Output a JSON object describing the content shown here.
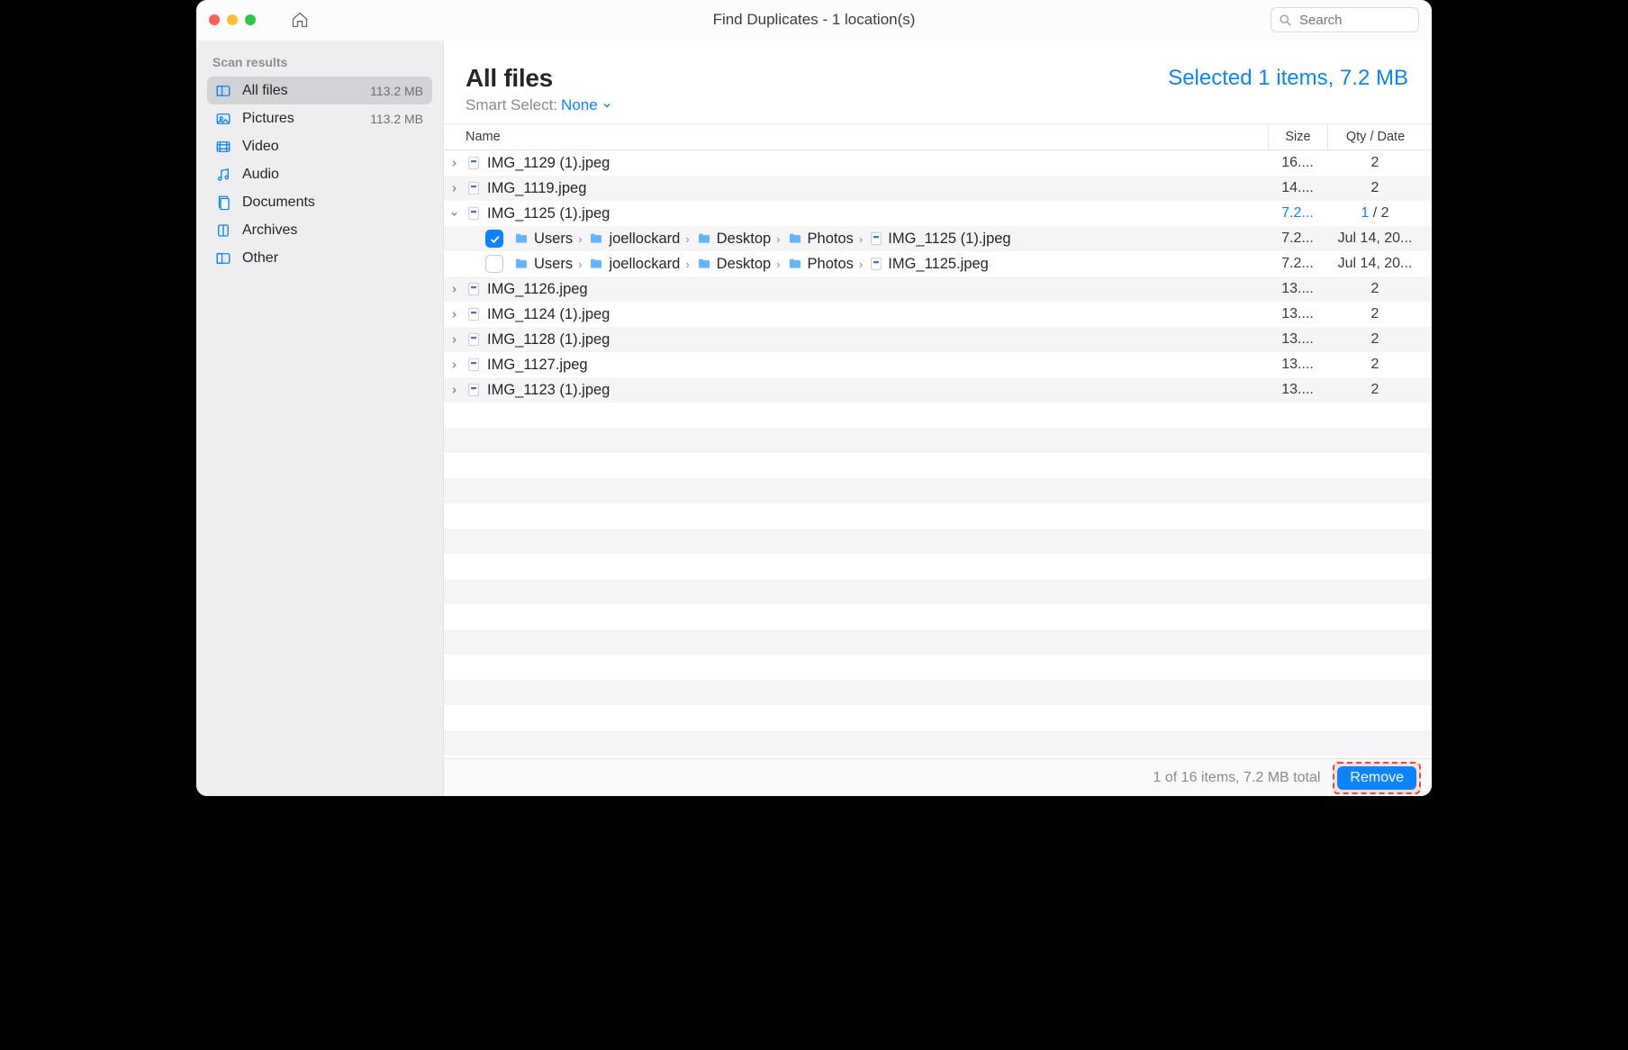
{
  "window_title": "Find Duplicates - 1 location(s)",
  "search": {
    "placeholder": "Search"
  },
  "sidebar": {
    "header": "Scan results",
    "items": [
      {
        "label": "All files",
        "meta": "113.2 MB",
        "icon": "allfiles",
        "active": true
      },
      {
        "label": "Pictures",
        "meta": "113.2 MB",
        "icon": "pictures",
        "active": false
      },
      {
        "label": "Video",
        "meta": "",
        "icon": "video",
        "active": false
      },
      {
        "label": "Audio",
        "meta": "",
        "icon": "audio",
        "active": false
      },
      {
        "label": "Documents",
        "meta": "",
        "icon": "documents",
        "active": false
      },
      {
        "label": "Archives",
        "meta": "",
        "icon": "archives",
        "active": false
      },
      {
        "label": "Other",
        "meta": "",
        "icon": "other",
        "active": false
      }
    ]
  },
  "main": {
    "title": "All files",
    "selection_summary": "Selected 1 items, 7.2 MB",
    "smart_select_label": "Smart Select:",
    "smart_select_value": "None"
  },
  "columns": {
    "name": "Name",
    "size": "Size",
    "qty": "Qty / Date"
  },
  "rows": [
    {
      "type": "group",
      "expanded": false,
      "name": "IMG_1129 (1).jpeg",
      "size": "16....",
      "qty": "2"
    },
    {
      "type": "group",
      "expanded": false,
      "name": "IMG_1119.jpeg",
      "size": "14....",
      "qty": "2"
    },
    {
      "type": "group",
      "expanded": true,
      "name": "IMG_1125 (1).jpeg",
      "size": "7.2...",
      "qty_sel": "1",
      "qty_total": "2"
    },
    {
      "type": "detail",
      "checked": true,
      "path": [
        "Users",
        "joellockard",
        "Desktop",
        "Photos"
      ],
      "file": "IMG_1125 (1).jpeg",
      "size": "7.2...",
      "date": "Jul 14, 20..."
    },
    {
      "type": "detail",
      "checked": false,
      "path": [
        "Users",
        "joellockard",
        "Desktop",
        "Photos"
      ],
      "file": "IMG_1125.jpeg",
      "size": "7.2...",
      "date": "Jul 14, 20..."
    },
    {
      "type": "group",
      "expanded": false,
      "name": "IMG_1126.jpeg",
      "size": "13....",
      "qty": "2"
    },
    {
      "type": "group",
      "expanded": false,
      "name": "IMG_1124 (1).jpeg",
      "size": "13....",
      "qty": "2"
    },
    {
      "type": "group",
      "expanded": false,
      "name": "IMG_1128 (1).jpeg",
      "size": "13....",
      "qty": "2"
    },
    {
      "type": "group",
      "expanded": false,
      "name": "IMG_1127.jpeg",
      "size": "13....",
      "qty": "2"
    },
    {
      "type": "group",
      "expanded": false,
      "name": "IMG_1123 (1).jpeg",
      "size": "13....",
      "qty": "2"
    }
  ],
  "footer": {
    "summary": "1 of 16 items, 7.2 MB total",
    "remove_label": "Remove"
  }
}
